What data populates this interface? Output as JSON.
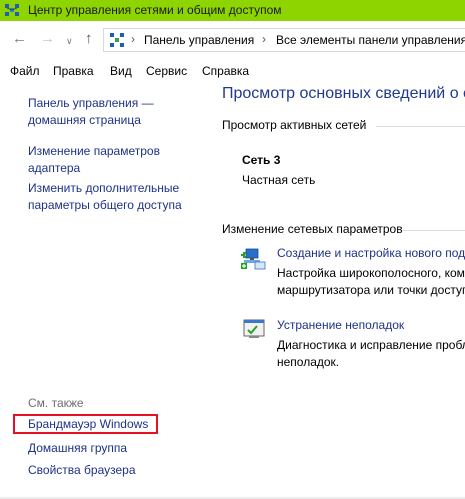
{
  "window": {
    "title": "Центр управления сетями и общим доступом"
  },
  "address": {
    "crumbs": [
      "Панель управления",
      "Все элементы панели управления"
    ]
  },
  "menu": [
    "Файл",
    "Правка",
    "Вид",
    "Сервис",
    "Справка"
  ],
  "sidebar": {
    "home": [
      "Панель управления —",
      "домашняя страница"
    ],
    "adapter": [
      "Изменение параметров",
      "адаптера"
    ],
    "sharing": [
      "Изменить дополнительные",
      "параметры общего доступа"
    ],
    "see_also_label": "См. также",
    "see_also": [
      "Брандмауэр Windows",
      "Домашняя группа",
      "Свойства браузера"
    ]
  },
  "main": {
    "heading": "Просмотр основных сведений о се",
    "active_networks": "Просмотр активных сетей",
    "network": {
      "name": "Сеть  3",
      "type": "Частная сеть"
    },
    "change_settings": "Изменение сетевых параметров",
    "tasks": [
      {
        "title": "Создание и настройка нового подк",
        "desc": [
          "Настройка широкополосного, ком",
          "маршрутизатора или точки доступ"
        ]
      },
      {
        "title": "Устранение неполадок",
        "desc": [
          "Диагностика и исправление пробл",
          "неполадок."
        ]
      }
    ]
  },
  "colors": {
    "titlebar": "#8ed400",
    "link": "#1e3287",
    "highlight": "#e81123"
  }
}
